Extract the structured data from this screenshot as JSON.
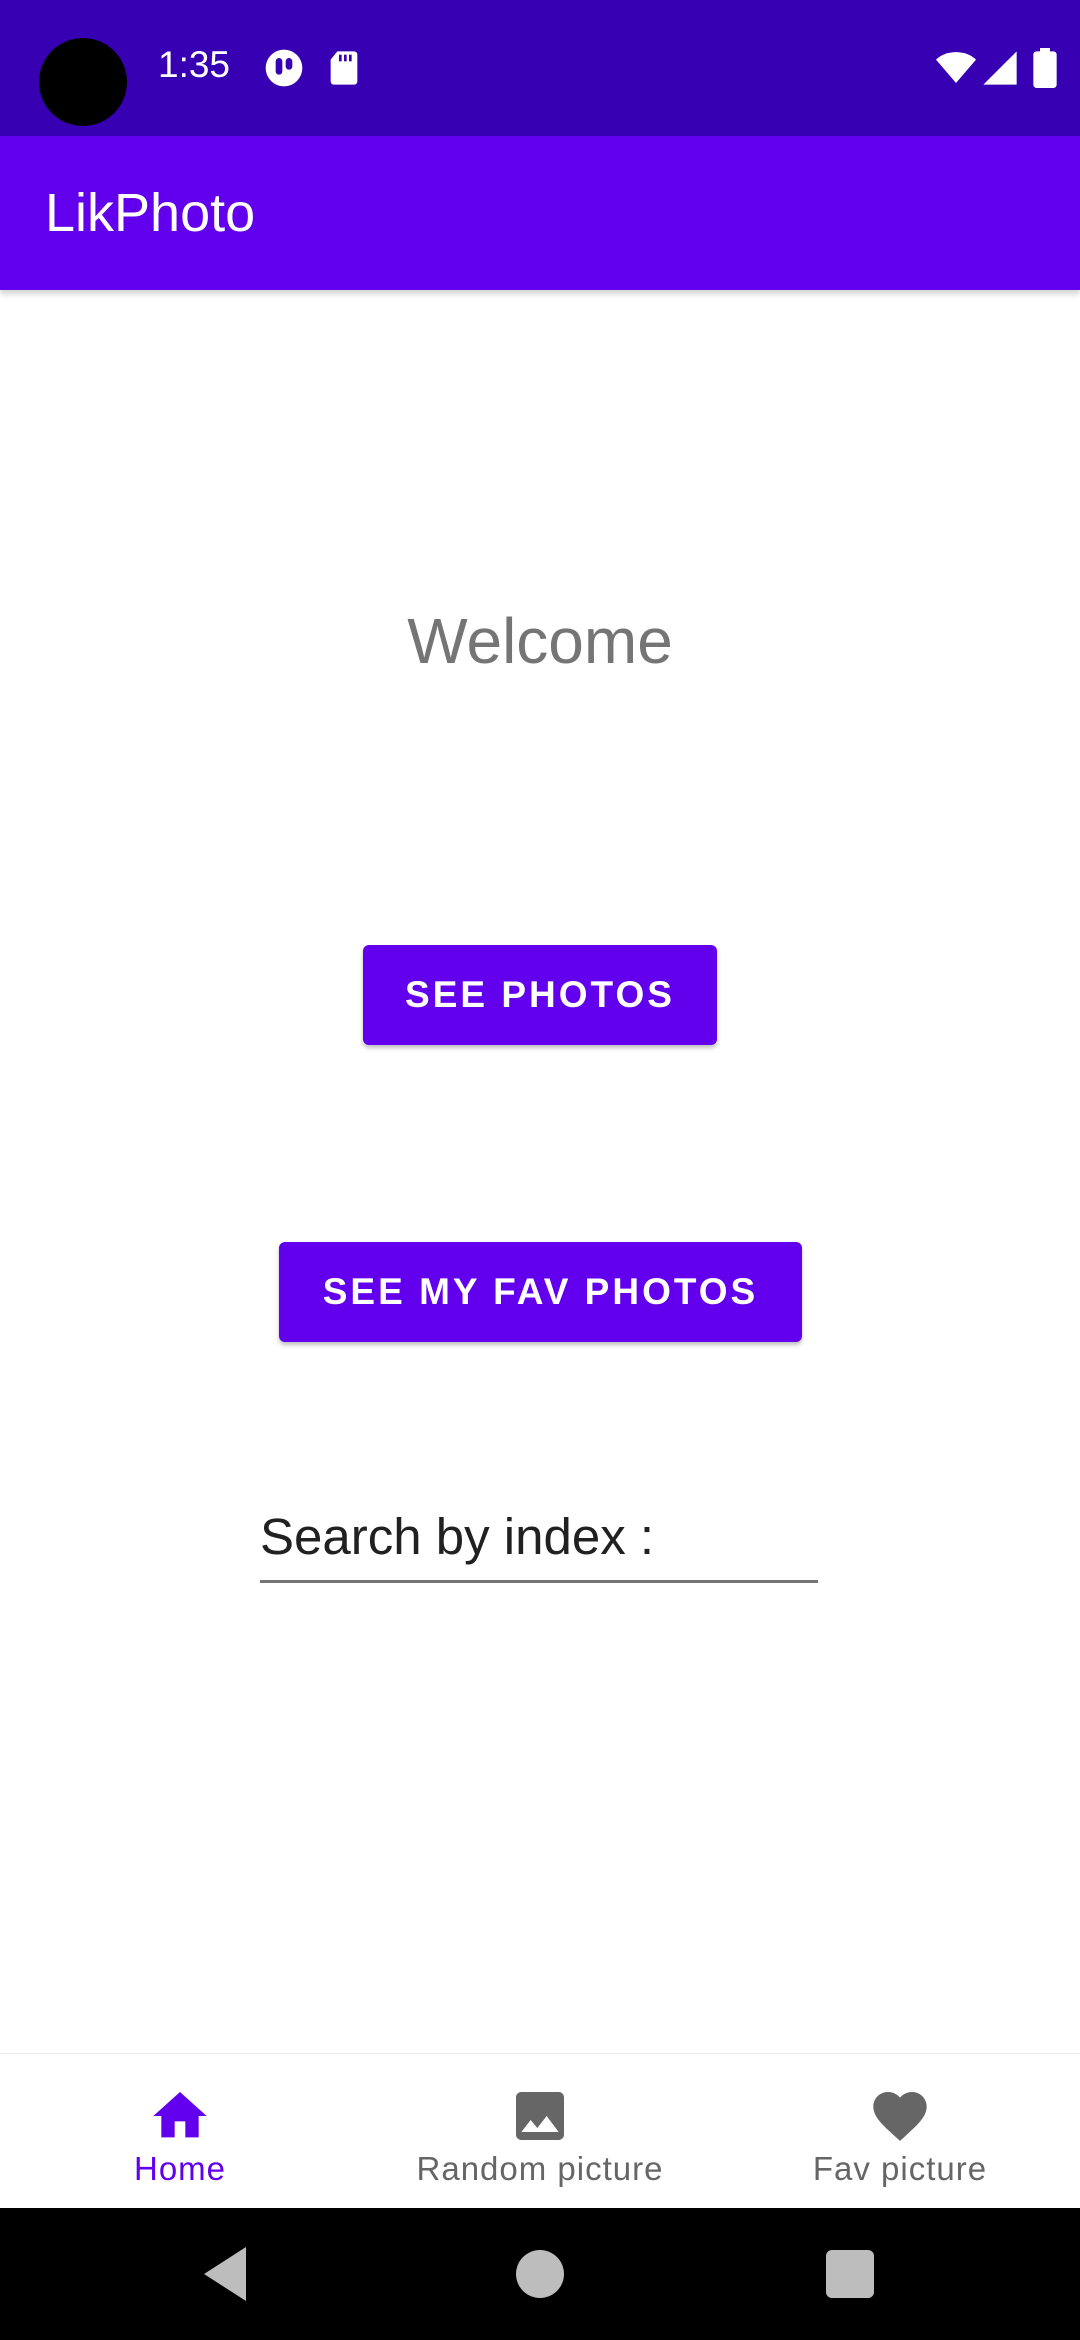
{
  "status_bar": {
    "time": "1:35",
    "icons": [
      "notification-app-icon",
      "sd-card-icon",
      "wifi-icon",
      "signal-icon",
      "battery-icon"
    ]
  },
  "app_bar": {
    "title": "LikPhoto"
  },
  "main": {
    "welcome": "Welcome",
    "see_photos_label": "SEE PHOTOS",
    "see_fav_photos_label": "SEE MY FAV PHOTOS",
    "search_placeholder": "Search by index :"
  },
  "bottom_nav": {
    "items": [
      {
        "label": "Home",
        "icon": "home-icon",
        "active": true
      },
      {
        "label": "Random picture",
        "icon": "image-icon",
        "active": false
      },
      {
        "label": "Fav picture",
        "icon": "heart-icon",
        "active": false
      }
    ]
  },
  "system_nav": {
    "buttons": [
      "back-icon",
      "home-circle-icon",
      "recents-icon"
    ]
  },
  "colors": {
    "primary": "#6200EE",
    "primary_dark": "#3700B3",
    "text_secondary": "#757575"
  }
}
